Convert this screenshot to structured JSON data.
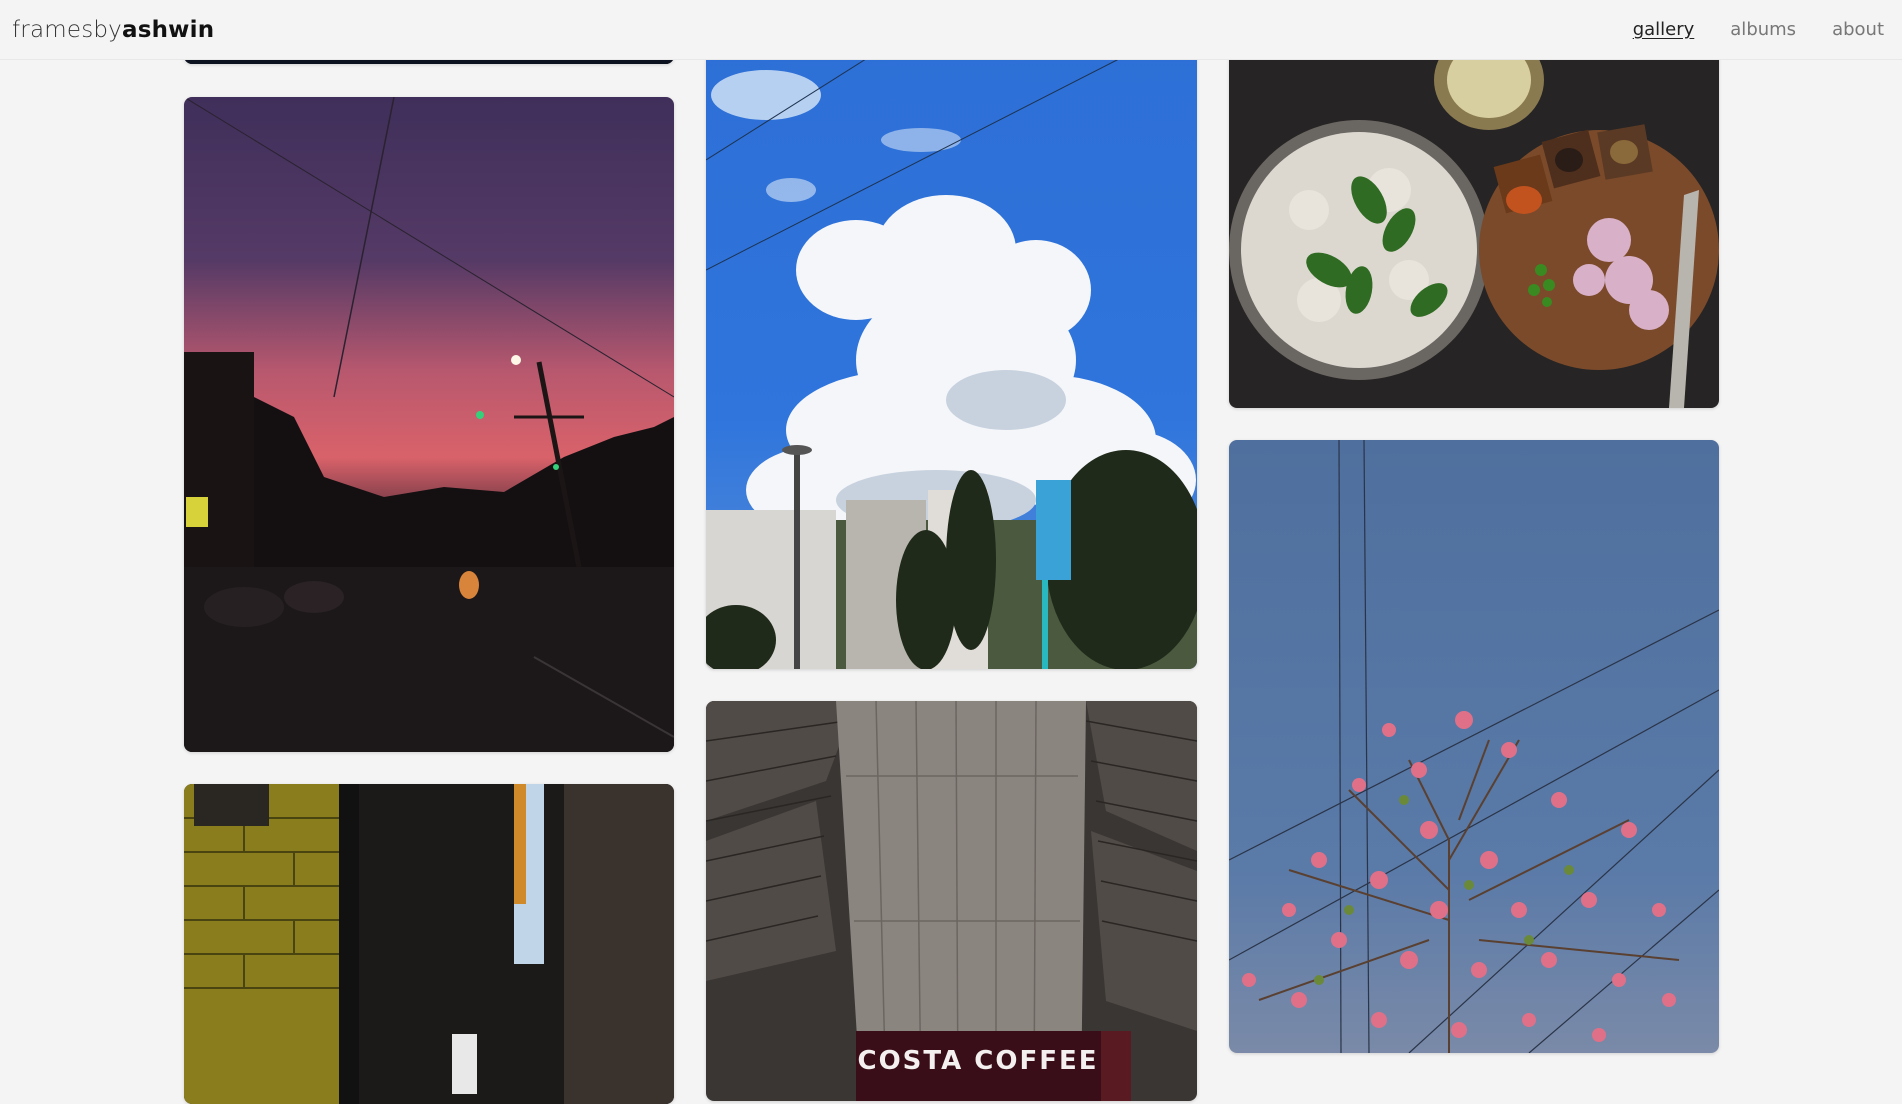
{
  "header": {
    "brand_light": "framesby",
    "brand_bold": "ashwin",
    "nav": [
      {
        "label": "gallery",
        "active": true
      },
      {
        "label": "albums",
        "active": false
      },
      {
        "label": "about",
        "active": false
      }
    ]
  },
  "photos": {
    "cafe_sign": "COSTA COFFEE"
  }
}
